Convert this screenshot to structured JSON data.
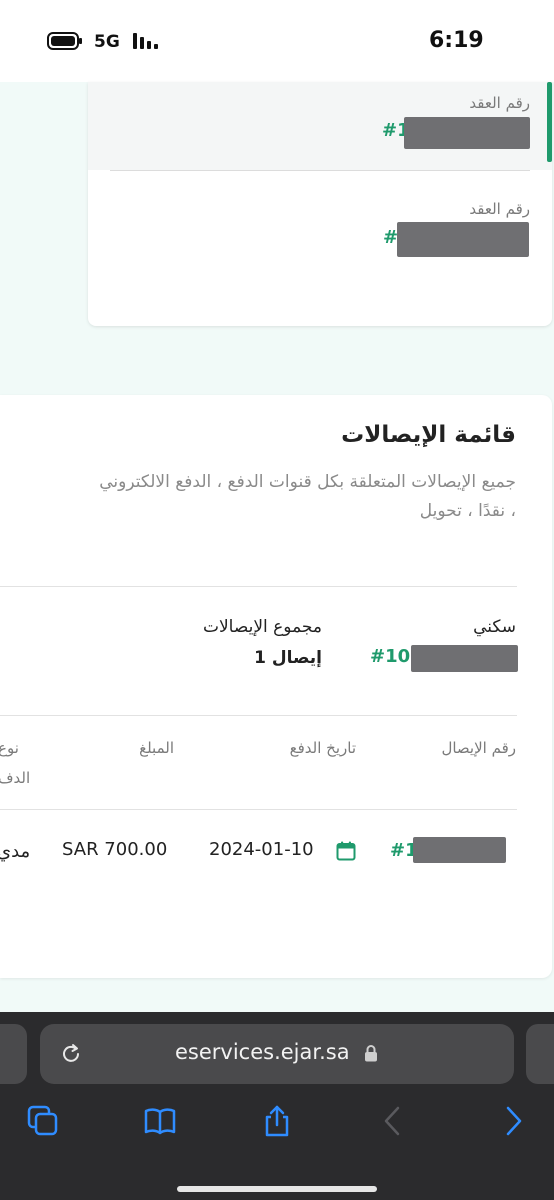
{
  "status_bar": {
    "time": "6:19",
    "network": "5G"
  },
  "contracts": {
    "label": "رقم العقد",
    "items": [
      {
        "prefix": "#1"
      },
      {
        "prefix": "#"
      }
    ]
  },
  "receipts": {
    "title": "قائمة الإيصالات",
    "description": "جميع الإيصالات المتعلقة بكل قنوات الدفع ، الدفع الالكتروني ، نقدًا ، تحويل",
    "summary": {
      "category_label": "سكني",
      "contract_prefix": "#105",
      "total_label": "مجموع الإيصالات",
      "total_value": "1 إيصال"
    },
    "table": {
      "headers": {
        "receipt_number": "رقم الإيصال",
        "payment_date": "تاريخ الدفع",
        "amount": "المبلغ",
        "payment_type_line1": "نوع",
        "payment_type_line2": "الدف"
      },
      "rows": [
        {
          "receipt_prefix": "#1",
          "date": "2024-01-10",
          "amount": "SAR 700.00",
          "payment_type": "مدي"
        }
      ]
    }
  },
  "browser": {
    "url": "eservices.ejar.sa",
    "icons": [
      "tabs-icon",
      "bookmarks-icon",
      "share-icon",
      "back-icon",
      "forward-icon"
    ]
  },
  "colors": {
    "accent": "#1f9a6c",
    "page_background": "#f1faf8",
    "browser_bar": "#2b2b2d"
  }
}
